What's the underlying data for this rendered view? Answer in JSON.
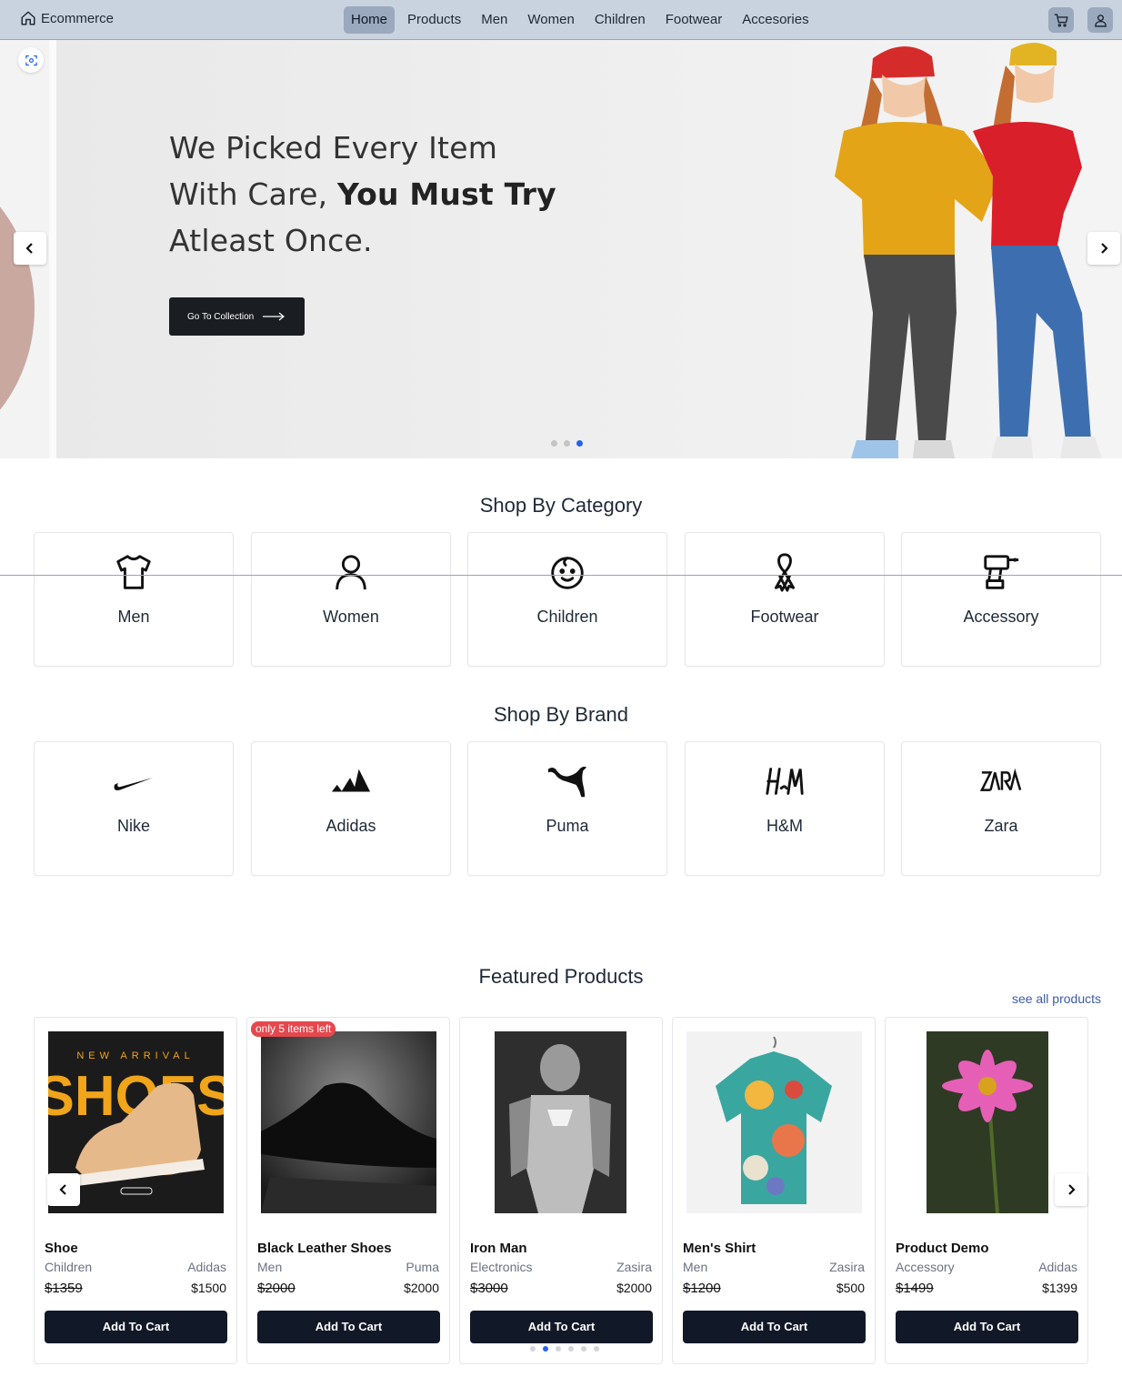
{
  "nav": {
    "brand": "Ecommerce",
    "links": [
      "Home",
      "Products",
      "Men",
      "Women",
      "Children",
      "Footwear",
      "Accesories"
    ],
    "active": "Home"
  },
  "hero": {
    "line1": "We Picked Every Item",
    "line2_normal": "With Care, ",
    "line2_bold": "You Must Try",
    "line3": "Atleast Once.",
    "cta_label": "Go To Collection",
    "slides_total": 3,
    "slide_active": 3
  },
  "categories": {
    "title": "Shop By Category",
    "items": [
      {
        "label": "Men",
        "icon": "tshirt-icon"
      },
      {
        "label": "Women",
        "icon": "person-icon"
      },
      {
        "label": "Children",
        "icon": "baby-face-icon"
      },
      {
        "label": "Footwear",
        "icon": "ribbon-icon"
      },
      {
        "label": "Accessory",
        "icon": "drill-icon"
      }
    ]
  },
  "brands": {
    "title": "Shop By Brand",
    "items": [
      {
        "label": "Nike",
        "icon": "nike-logo-icon"
      },
      {
        "label": "Adidas",
        "icon": "adidas-logo-icon"
      },
      {
        "label": "Puma",
        "icon": "puma-logo-icon"
      },
      {
        "label": "H&M",
        "icon": "hm-logo-icon"
      },
      {
        "label": "Zara",
        "icon": "zara-logo-icon"
      }
    ]
  },
  "featured": {
    "title": "Featured Products",
    "see_all": "see all products",
    "stock_badge": "only 5 items left",
    "products": [
      {
        "name": "Shoe",
        "category": "Children",
        "brand": "Adidas",
        "old_price": "$1359",
        "price": "$1500",
        "button": "Add To Cart",
        "image_text_top": "NEW ARRIVAL",
        "image_text_big": "SHOES"
      },
      {
        "name": "Black Leather Shoes",
        "category": "Men",
        "brand": "Puma",
        "old_price": "$2000",
        "price": "$2000",
        "button": "Add To Cart"
      },
      {
        "name": "Iron Man",
        "category": "Electronics",
        "brand": "Zasira",
        "old_price": "$3000",
        "price": "$2000",
        "button": "Add To Cart"
      },
      {
        "name": "Men's Shirt",
        "category": "Men",
        "brand": "Zasira",
        "old_price": "$1200",
        "price": "$500",
        "button": "Add To Cart"
      },
      {
        "name": "Product Demo",
        "category": "Accessory",
        "brand": "Adidas",
        "old_price": "$1499",
        "price": "$1399",
        "button": "Add To Cart"
      }
    ],
    "pages_total": 6,
    "page_active": 2
  },
  "colors": {
    "navbar": "#c9d3df",
    "active_link": "#9aa9bd",
    "button_dark": "#111827",
    "accent_blue": "#2563eb",
    "badge_red": "#e5484d",
    "link_blue": "#3b5bab"
  }
}
